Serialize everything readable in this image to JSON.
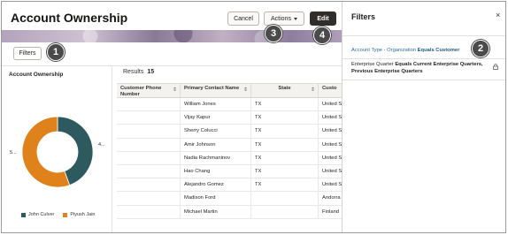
{
  "page": {
    "title": "Account Ownership",
    "buttons": {
      "cancel": "Cancel",
      "actions": "Actions",
      "edit": "Edit",
      "filters": "Filters"
    },
    "callouts": [
      "1",
      "2",
      "3",
      "4"
    ]
  },
  "chart_panel": {
    "title": "Account Ownership",
    "left_label": "5...",
    "right_label": "4...",
    "legend": [
      {
        "name": "John Culver",
        "color": "#2d5a5e"
      },
      {
        "name": "Piyush Jain",
        "color": "#e0821c"
      }
    ]
  },
  "chart_data": {
    "type": "pie",
    "series": [
      {
        "name": "John Culver",
        "value": 4,
        "color": "#2d5a5e"
      },
      {
        "name": "Piyush Jain",
        "value": 5,
        "color": "#e0821c"
      }
    ],
    "labels": [
      "4...",
      "5..."
    ],
    "legend_placement": "bottom"
  },
  "table": {
    "results_label": "Results",
    "results_count": "15",
    "columns": [
      "Customer Phone Number",
      "Primary Contact Name",
      "State",
      "Custo"
    ],
    "rows": [
      [
        "",
        "William Jones",
        "TX",
        "United S"
      ],
      [
        "",
        "Vijay Kapur",
        "TX",
        "United S"
      ],
      [
        "",
        "Sherry Colucci",
        "TX",
        "United S"
      ],
      [
        "",
        "Amir Johnson",
        "TX",
        "United S"
      ],
      [
        "",
        "Nadia Rachmaninov",
        "TX",
        "United S"
      ],
      [
        "",
        "Hao Chang",
        "TX",
        "United S"
      ],
      [
        "",
        "Alejandro Gomez",
        "TX",
        "United S"
      ],
      [
        "",
        "Madison Ford",
        "",
        "Andorra"
      ],
      [
        "",
        "Michael Martin",
        "",
        "Finland"
      ]
    ]
  },
  "filters_panel": {
    "title": "Filters",
    "close": "×",
    "filter1_prefix": "Account Type - Organization",
    "filter1_bold": "Equals Customer",
    "filter2_prefix": "Enterprise Quarter",
    "filter2_bold": "Equals Current Enterprise Quarters, Previous Enterprise Quarters"
  }
}
